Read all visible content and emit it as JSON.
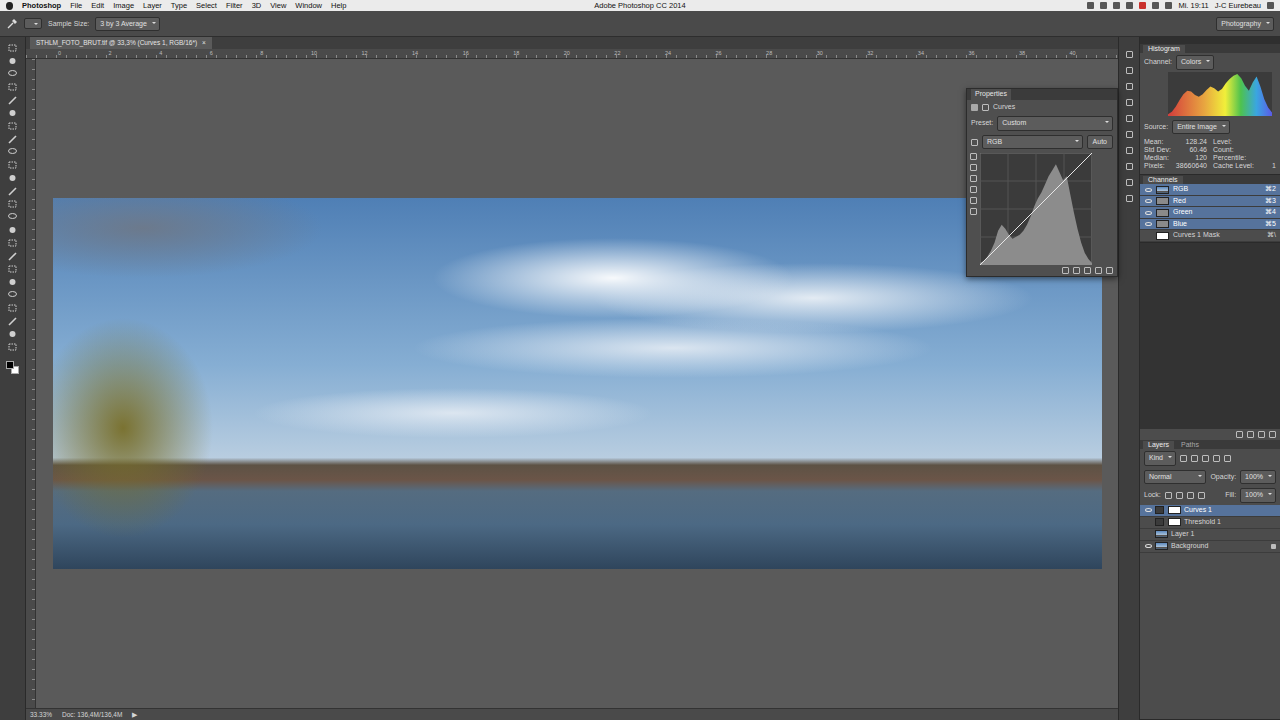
{
  "menubar": {
    "app": "Photoshop",
    "items": [
      "File",
      "Edit",
      "Image",
      "Layer",
      "Type",
      "Select",
      "Filter",
      "3D",
      "View",
      "Window",
      "Help"
    ],
    "clock": "Mi. 19:11",
    "user": "J-C Eurebeau"
  },
  "window": {
    "title": "Adobe Photoshop CC 2014"
  },
  "options": {
    "sample_size_label": "Sample Size:",
    "sample_size": "3 by 3 Average",
    "workspace": "Photography"
  },
  "document": {
    "tab": "STHLM_FOTO_BRUT.tif @ 33,3% (Curves 1, RGB/16*)",
    "close": "×",
    "ruler": [
      "0",
      "2",
      "4",
      "6",
      "8",
      "10",
      "12",
      "14",
      "16",
      "18",
      "20",
      "22",
      "24",
      "26",
      "28",
      "30",
      "32",
      "34",
      "36",
      "38",
      "40"
    ],
    "zoom": "33.33%",
    "doc_info": "Doc: 136,4M/136,4M",
    "status_arrow": "▶"
  },
  "properties": {
    "title": "Properties",
    "adjustment": "Curves",
    "preset_label": "Preset:",
    "preset": "Custom",
    "channel": "RGB",
    "auto": "Auto",
    "histogram": [
      2,
      4,
      8,
      14,
      22,
      34,
      40,
      36,
      30,
      26,
      28,
      30,
      34,
      40,
      48,
      58,
      66,
      72,
      80,
      88,
      94,
      100,
      92,
      84,
      88,
      70,
      52,
      36,
      22,
      12,
      6,
      2
    ],
    "curve": [
      [
        0,
        0
      ],
      [
        255,
        255
      ]
    ]
  },
  "histogram": {
    "title": "Histogram",
    "channel_label": "Channel:",
    "channel": "Colors",
    "source_label": "Source:",
    "source": "Entire Image",
    "values": [
      4,
      10,
      22,
      38,
      52,
      60,
      58,
      50,
      46,
      52,
      62,
      70,
      66,
      58,
      64,
      78,
      88,
      96,
      100,
      90,
      72,
      60,
      80,
      94,
      70,
      40,
      20,
      8
    ],
    "stats": [
      {
        "label": "Mean:",
        "value": "128.24"
      },
      {
        "label": "Level:",
        "value": ""
      },
      {
        "label": "Std Dev:",
        "value": "60.46"
      },
      {
        "label": "Count:",
        "value": ""
      },
      {
        "label": "Median:",
        "value": "120"
      },
      {
        "label": "Percentile:",
        "value": ""
      },
      {
        "label": "Pixels:",
        "value": "38660640"
      },
      {
        "label": "Cache Level:",
        "value": "1"
      }
    ]
  },
  "channels": {
    "title": "Channels",
    "rows": [
      {
        "name": "RGB",
        "shortcut": "⌘2",
        "selected": true,
        "visible": true,
        "kind": "photo"
      },
      {
        "name": "Red",
        "shortcut": "⌘3",
        "selected": true,
        "visible": true,
        "kind": "grey"
      },
      {
        "name": "Green",
        "shortcut": "⌘4",
        "selected": true,
        "visible": true,
        "kind": "grey"
      },
      {
        "name": "Blue",
        "shortcut": "⌘5",
        "selected": true,
        "visible": true,
        "kind": "grey"
      },
      {
        "name": "Curves 1 Mask",
        "shortcut": "⌘\\",
        "selected": false,
        "visible": false,
        "kind": "mask"
      }
    ]
  },
  "layers": {
    "tabs": [
      {
        "label": "Layers",
        "selected": true
      },
      {
        "label": "Paths",
        "selected": false
      }
    ],
    "filter": "Kind",
    "blend": "Normal",
    "opacity_label": "Opacity:",
    "opacity": "100%",
    "lock_label": "Lock:",
    "fill_label": "Fill:",
    "fill": "100%",
    "rows": [
      {
        "name": "Curves 1",
        "kind": "adjustment",
        "selected": true,
        "visible": true,
        "locked": false
      },
      {
        "name": "Threshold 1",
        "kind": "adjustment",
        "selected": false,
        "visible": false,
        "locked": false
      },
      {
        "name": "Layer 1",
        "kind": "pixel",
        "selected": false,
        "visible": false,
        "locked": false
      },
      {
        "name": "Background",
        "kind": "pixel",
        "selected": false,
        "visible": true,
        "locked": true
      }
    ]
  }
}
